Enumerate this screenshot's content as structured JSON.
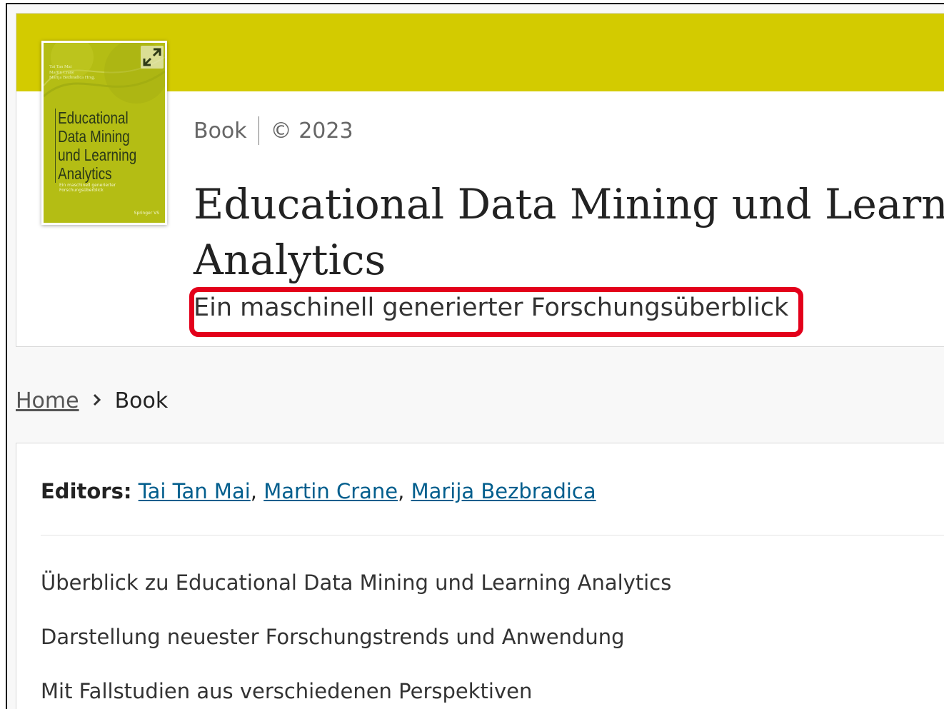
{
  "colors": {
    "brand_band": "#d3cb00",
    "cover_green": "#b4bd14",
    "link": "#025e8d",
    "highlight": "#e3001b"
  },
  "cover": {
    "editors_lines": [
      "Tai Tan Mai",
      "Martin Crane",
      "Marija Bezbradica  Hrsg."
    ],
    "title": "Educational Data Mining und Learning Analytics",
    "subtitle": "Ein maschinell generierter Forschungsüberblick",
    "publisher": "Springer VS",
    "expand_icon": "expand-icon"
  },
  "meta": {
    "type": "Book",
    "copyright": "© 2023"
  },
  "title": {
    "line1": "Educational Data Mining und Learning",
    "line2": "Analytics"
  },
  "subtitle": "Ein maschinell generierter Forschungsüberblick",
  "breadcrumb": {
    "home": "Home",
    "separator_icon": "chevron-right-icon",
    "current": "Book"
  },
  "editors": {
    "label": "Editors:",
    "names": [
      "Tai Tan Mai",
      "Martin Crane",
      "Marija Bezbradica"
    ],
    "separator": ", "
  },
  "features": [
    "Überblick zu Educational Data Mining und Learning Analytics",
    "Darstellung neuester Forschungstrends und Anwendung",
    "Mit Fallstudien aus verschiedenen Perspektiven"
  ]
}
